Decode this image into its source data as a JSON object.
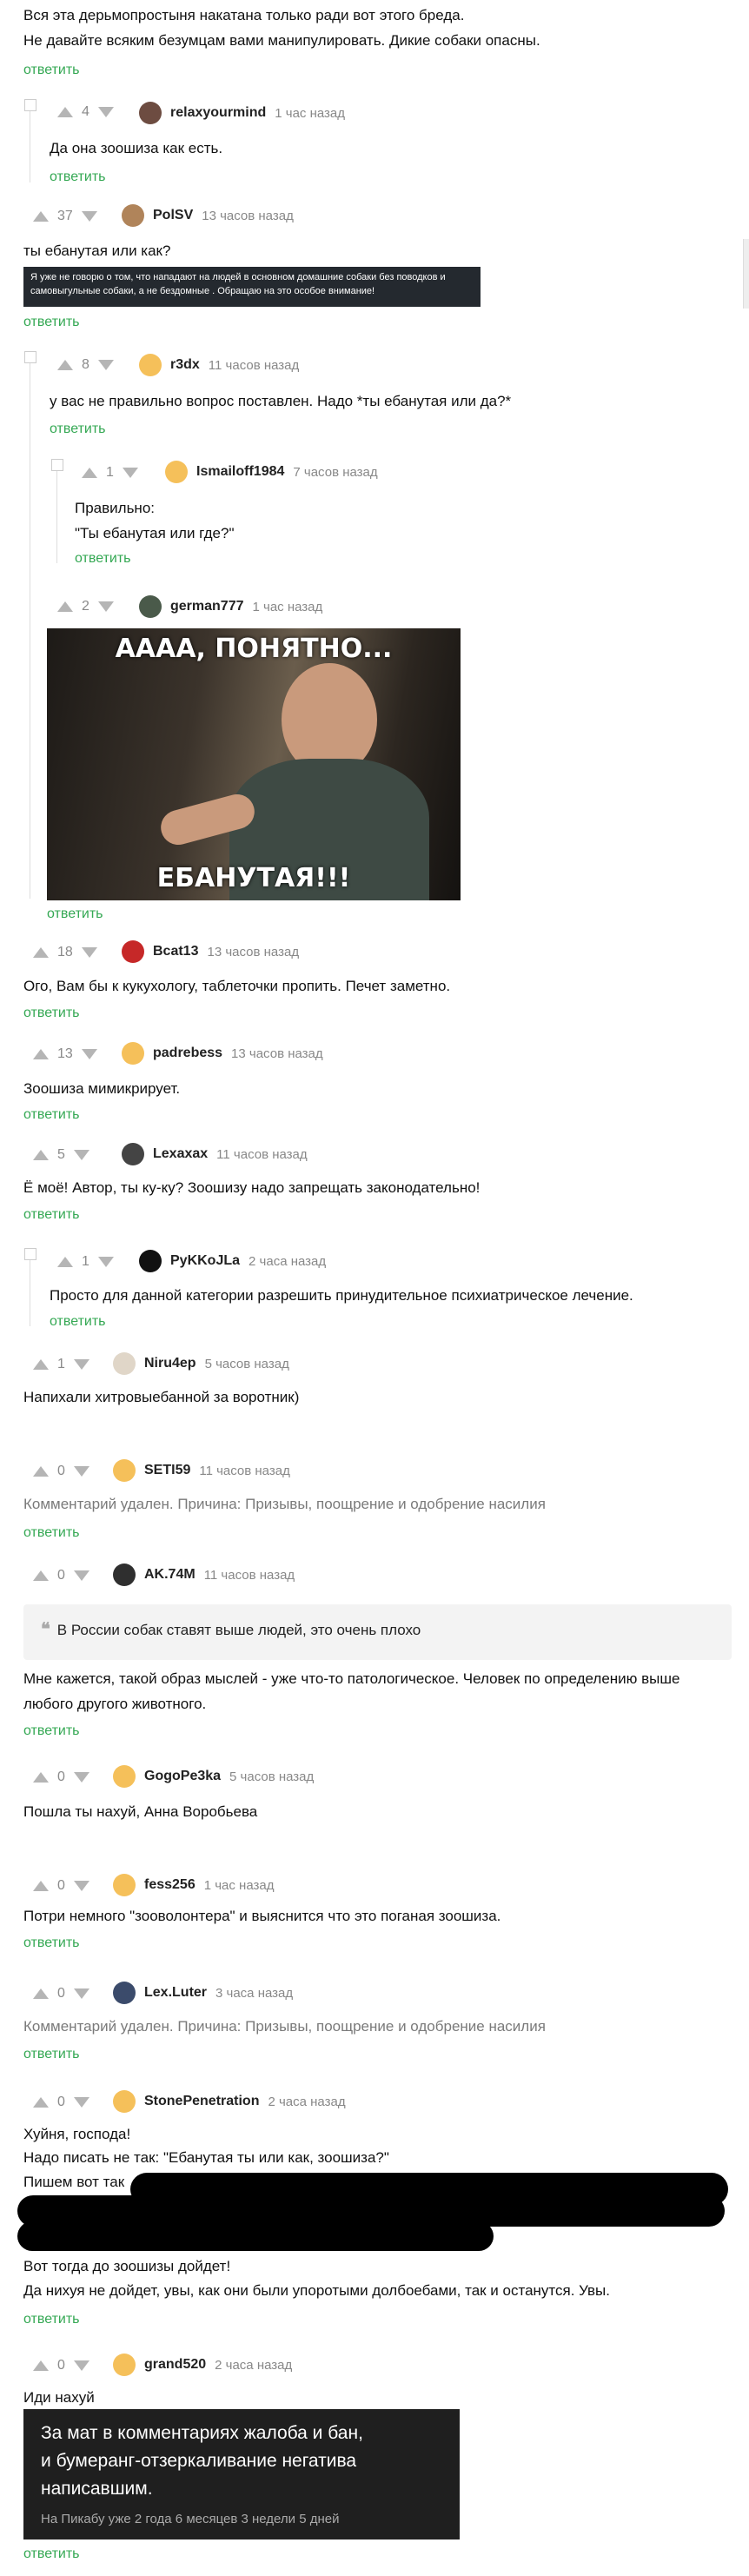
{
  "lines": {
    "intro_1": "Вся эта дерьмопростыня накатана только ради вот этого бреда.",
    "intro_2": "Не давайте всяким безумцам вами манипулировать. Дикие собаки опасны.",
    "reply": "ответить"
  },
  "comments": [
    {
      "votes": "4",
      "user": "relaxyourmind",
      "time": "1 час назад",
      "text": "Да она зоошиза как есть."
    },
    {
      "votes": "37",
      "user": "PolSV",
      "time": "13 часов назад",
      "text": "ты ебанутая или как?",
      "banner": "Я уже не говорю о том, что нападают на людей в основном домашние собаки без поводков и самовыгульные собаки, а не бездомные . Обращаю на это особое внимание!"
    },
    {
      "votes": "8",
      "user": "r3dx",
      "time": "11 часов назад",
      "text": "у вас не правильно вопрос поставлен. Надо *ты ебанутая или да?*"
    },
    {
      "votes": "1",
      "user": "Ismailoff1984",
      "time": "7 часов назад",
      "text": "Правильно:",
      "text2": "\"Ты ебанутая или где?\""
    },
    {
      "votes": "2",
      "user": "german777",
      "time": "1 час назад",
      "img_top": "АААА, ПОНЯТНО...",
      "img_bottom": "ЕБАНУТАЯ!!!"
    },
    {
      "votes": "18",
      "user": "Bcat13",
      "time": "13 часов назад",
      "text": "Ого, Вам бы к кукухологу, таблеточки пропить. Печет заметно."
    },
    {
      "votes": "13",
      "user": "padrebess",
      "time": "13 часов назад",
      "text": "Зоошиза мимикрирует."
    },
    {
      "votes": "5",
      "user": "Lexaxax",
      "time": "11 часов назад",
      "text": "Ё моё! Автор, ты ку-ку? Зоошизу надо запрещать законодательно!"
    },
    {
      "votes": "1",
      "user": "PyKKoJLa",
      "time": "2 часа назад",
      "text": "Просто для данной категории разрешить принудительное психиатрическое лечение."
    },
    {
      "votes": "1",
      "user": "Niru4ep",
      "time": "5 часов назад",
      "text": "Напихали хитровыебанной за воротник)"
    },
    {
      "votes": "0",
      "user": "SETI59",
      "time": "11 часов назад",
      "text": "Комментарий удален. Причина: Призывы, поощрение и одобрение насилия"
    },
    {
      "votes": "0",
      "user": "AK.74M",
      "time": "11 часов назад",
      "quote": "В России собак ставят выше людей, это очень плохо",
      "text": "Мне кажется, такой образ мыслей - уже что-то патологическое. Человек по определению выше",
      "text2": "любого другого животного."
    },
    {
      "votes": "0",
      "user": "GogoPe3ka",
      "time": "5 часов назад",
      "text": "Пошла ты нахуй, Анна Воробьева"
    },
    {
      "votes": "0",
      "user": "fess256",
      "time": "1 час назад",
      "text": "Потри немного \"зооволонтера\" и выяснится что это поганая зоошиза."
    },
    {
      "votes": "0",
      "user": "Lex.Luter",
      "time": "3 часа назад",
      "text": "Комментарий удален. Причина: Призывы, поощрение и одобрение насилия"
    },
    {
      "votes": "0",
      "user": "StonePenetration",
      "time": "2 часа назад",
      "text": "Хуйня, господа!",
      "text2": "Надо писать не так: \"Ебанутая ты или как, зоошиза?\"",
      "text3": "Пишем вот так",
      "text4": "Вот тогда до зоошизы дойдет!",
      "text5": "Да нихуя не дойдет, увы, как они были упоротыми долбоебами, так и останутся. Увы."
    },
    {
      "votes": "0",
      "user": "grand520",
      "time": "2 часа назад",
      "text": "Иди нахуй",
      "sig1": "За мат в комментариях жалоба и бан,",
      "sig2": "и бумеранг-отзеркаливание негатива",
      "sig3": "написавшим.",
      "sig4": "На Пикабу уже 2 года 6 месяцев 3 недели 5 дней"
    }
  ],
  "colors": {
    "reply": "#34a853",
    "meta": "#888888",
    "banner": "#24292f"
  }
}
